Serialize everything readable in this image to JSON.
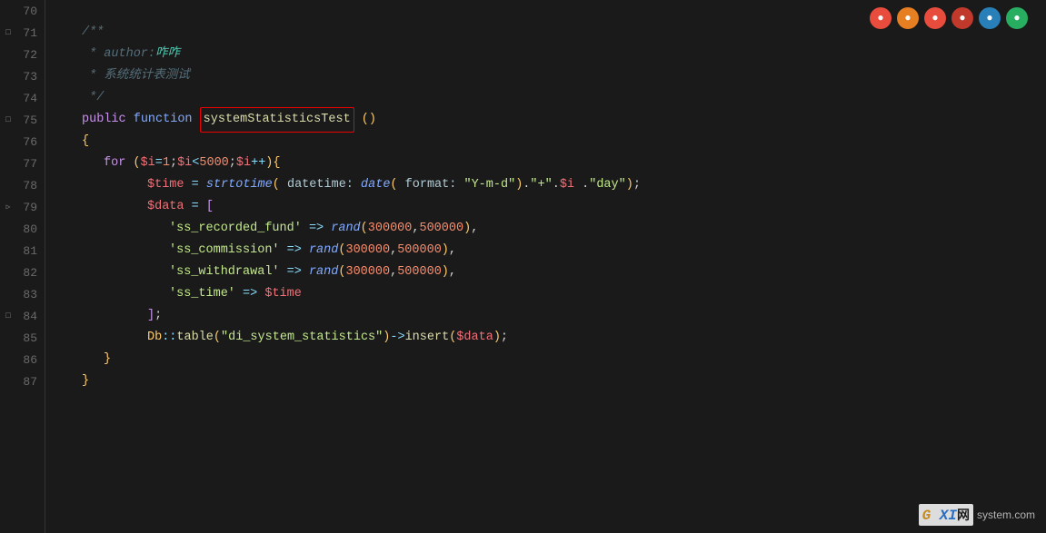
{
  "lines": [
    {
      "num": 70,
      "fold": null,
      "tokens": []
    },
    {
      "num": 71,
      "fold": "minus",
      "tokens": [
        {
          "t": "comment",
          "v": "/**"
        }
      ]
    },
    {
      "num": 72,
      "fold": null,
      "tokens": [
        {
          "t": "comment",
          "v": " * author:咋咋"
        }
      ]
    },
    {
      "num": 73,
      "fold": null,
      "tokens": [
        {
          "t": "comment",
          "v": " * 系统统计表测试"
        }
      ]
    },
    {
      "num": 74,
      "fold": null,
      "tokens": [
        {
          "t": "comment",
          "v": " */"
        }
      ]
    },
    {
      "num": 75,
      "fold": "minus",
      "tokens": [
        {
          "t": "kw",
          "v": "public"
        },
        {
          "t": "plain",
          "v": " "
        },
        {
          "t": "fn-kw",
          "v": "function"
        },
        {
          "t": "plain",
          "v": " "
        },
        {
          "t": "fn-name-highlight",
          "v": "systemStatisticsTest"
        },
        {
          "t": "plain",
          "v": " "
        },
        {
          "t": "paren",
          "v": "("
        },
        {
          "t": "paren",
          "v": ")"
        }
      ]
    },
    {
      "num": 76,
      "fold": null,
      "tokens": [
        {
          "t": "brace",
          "v": "{"
        }
      ]
    },
    {
      "num": 77,
      "fold": null,
      "tokens": [
        {
          "t": "indent1",
          "v": ""
        },
        {
          "t": "kw",
          "v": "for"
        },
        {
          "t": "plain",
          "v": " "
        },
        {
          "t": "paren",
          "v": "("
        },
        {
          "t": "variable",
          "v": "$i"
        },
        {
          "t": "operator",
          "v": "="
        },
        {
          "t": "number",
          "v": "1"
        },
        {
          "t": "plain",
          "v": ";"
        },
        {
          "t": "variable",
          "v": "$i"
        },
        {
          "t": "operator",
          "v": "<"
        },
        {
          "t": "number",
          "v": "5000"
        },
        {
          "t": "plain",
          "v": ";"
        },
        {
          "t": "variable",
          "v": "$i"
        },
        {
          "t": "operator",
          "v": "++"
        },
        {
          "t": "paren",
          "v": ")"
        },
        {
          "t": "brace",
          "v": "{"
        }
      ]
    },
    {
      "num": 78,
      "fold": null,
      "tokens": [
        {
          "t": "indent2",
          "v": ""
        },
        {
          "t": "variable",
          "v": "$time"
        },
        {
          "t": "plain",
          "v": " "
        },
        {
          "t": "operator",
          "v": "="
        },
        {
          "t": "plain",
          "v": " "
        },
        {
          "t": "php-func",
          "v": "strtotime"
        },
        {
          "t": "paren",
          "v": "("
        },
        {
          "t": "plain",
          "v": " "
        },
        {
          "t": "param-name",
          "v": "datetime:"
        },
        {
          "t": "plain",
          "v": " "
        },
        {
          "t": "php-func",
          "v": "date"
        },
        {
          "t": "paren",
          "v": "("
        },
        {
          "t": "plain",
          "v": " "
        },
        {
          "t": "param-name",
          "v": "format:"
        },
        {
          "t": "plain",
          "v": " "
        },
        {
          "t": "string",
          "v": "\"Y-m-d\""
        },
        {
          "t": "paren",
          "v": ")"
        },
        {
          "t": "plain",
          "v": "."
        },
        {
          "t": "string",
          "v": "\"+\""
        },
        {
          "t": "plain",
          "v": ". "
        },
        {
          "t": "variable",
          "v": "$i"
        },
        {
          "t": "plain",
          "v": " ."
        },
        {
          "t": "string",
          "v": "\"day\""
        },
        {
          "t": "paren",
          "v": ")"
        },
        {
          "t": "plain",
          "v": ";"
        }
      ]
    },
    {
      "num": 79,
      "fold": "triangle",
      "tokens": [
        {
          "t": "indent2",
          "v": ""
        },
        {
          "t": "variable",
          "v": "$data"
        },
        {
          "t": "plain",
          "v": " "
        },
        {
          "t": "operator",
          "v": "="
        },
        {
          "t": "plain",
          "v": " "
        },
        {
          "t": "bracket",
          "v": "["
        }
      ]
    },
    {
      "num": 80,
      "fold": null,
      "tokens": [
        {
          "t": "indent3",
          "v": ""
        },
        {
          "t": "string",
          "v": "'ss_recorded_fund'"
        },
        {
          "t": "plain",
          "v": " "
        },
        {
          "t": "arrow",
          "v": "=>"
        },
        {
          "t": "plain",
          "v": " "
        },
        {
          "t": "php-func",
          "v": "rand"
        },
        {
          "t": "paren",
          "v": "("
        },
        {
          "t": "number",
          "v": "300000"
        },
        {
          "t": "plain",
          "v": ","
        },
        {
          "t": "number",
          "v": "500000"
        },
        {
          "t": "paren",
          "v": ")"
        },
        {
          "t": "plain",
          "v": ","
        }
      ]
    },
    {
      "num": 81,
      "fold": null,
      "tokens": [
        {
          "t": "indent3",
          "v": ""
        },
        {
          "t": "string",
          "v": "'ss_commission'"
        },
        {
          "t": "plain",
          "v": " "
        },
        {
          "t": "arrow",
          "v": "=>"
        },
        {
          "t": "plain",
          "v": " "
        },
        {
          "t": "php-func",
          "v": "rand"
        },
        {
          "t": "paren",
          "v": "("
        },
        {
          "t": "number",
          "v": "300000"
        },
        {
          "t": "plain",
          "v": ","
        },
        {
          "t": "number",
          "v": "500000"
        },
        {
          "t": "paren",
          "v": ")"
        },
        {
          "t": "plain",
          "v": ","
        }
      ]
    },
    {
      "num": 82,
      "fold": null,
      "tokens": [
        {
          "t": "indent3",
          "v": ""
        },
        {
          "t": "string",
          "v": "'ss_withdrawal'"
        },
        {
          "t": "plain",
          "v": " "
        },
        {
          "t": "arrow",
          "v": "=>"
        },
        {
          "t": "plain",
          "v": " "
        },
        {
          "t": "php-func",
          "v": "rand"
        },
        {
          "t": "paren",
          "v": "("
        },
        {
          "t": "number",
          "v": "300000"
        },
        {
          "t": "plain",
          "v": ","
        },
        {
          "t": "number",
          "v": "500000"
        },
        {
          "t": "paren",
          "v": ")"
        },
        {
          "t": "plain",
          "v": ","
        }
      ]
    },
    {
      "num": 83,
      "fold": null,
      "tokens": [
        {
          "t": "indent3",
          "v": ""
        },
        {
          "t": "string",
          "v": "'ss_time'"
        },
        {
          "t": "plain",
          "v": " "
        },
        {
          "t": "arrow",
          "v": "=>"
        },
        {
          "t": "plain",
          "v": " "
        },
        {
          "t": "variable",
          "v": "$time"
        }
      ]
    },
    {
      "num": 84,
      "fold": "minus",
      "tokens": [
        {
          "t": "indent2",
          "v": ""
        },
        {
          "t": "bracket",
          "v": "]"
        },
        {
          "t": "plain",
          "v": ";"
        }
      ]
    },
    {
      "num": 85,
      "fold": null,
      "tokens": [
        {
          "t": "indent2",
          "v": ""
        },
        {
          "t": "class-name",
          "v": "Db"
        },
        {
          "t": "operator",
          "v": "::"
        },
        {
          "t": "fn-name",
          "v": "table"
        },
        {
          "t": "paren",
          "v": "("
        },
        {
          "t": "string",
          "v": "\"di_system_statistics\""
        },
        {
          "t": "paren",
          "v": ")"
        },
        {
          "t": "arrow",
          "v": "->"
        },
        {
          "t": "fn-name",
          "v": "insert"
        },
        {
          "t": "paren",
          "v": "("
        },
        {
          "t": "variable",
          "v": "$data"
        },
        {
          "t": "paren",
          "v": ")"
        },
        {
          "t": "plain",
          "v": ";"
        }
      ]
    },
    {
      "num": 86,
      "fold": null,
      "tokens": [
        {
          "t": "indent1",
          "v": ""
        },
        {
          "t": "brace",
          "v": "}"
        }
      ]
    },
    {
      "num": 87,
      "fold": null,
      "tokens": [
        {
          "t": "brace",
          "v": "}"
        }
      ]
    }
  ],
  "browser_icons": [
    {
      "color": "#e74c3c",
      "label": "chrome-icon"
    },
    {
      "color": "#e67e22",
      "label": "firefox-icon"
    },
    {
      "color": "#e74c3c",
      "label": "opera-icon"
    },
    {
      "color": "#c0392b",
      "label": "chrome-dev-icon"
    },
    {
      "color": "#3498db",
      "label": "ie-icon"
    },
    {
      "color": "#2ecc71",
      "label": "edge-icon"
    }
  ],
  "watermark": {
    "logo": "G XI网",
    "url": "system.com"
  }
}
